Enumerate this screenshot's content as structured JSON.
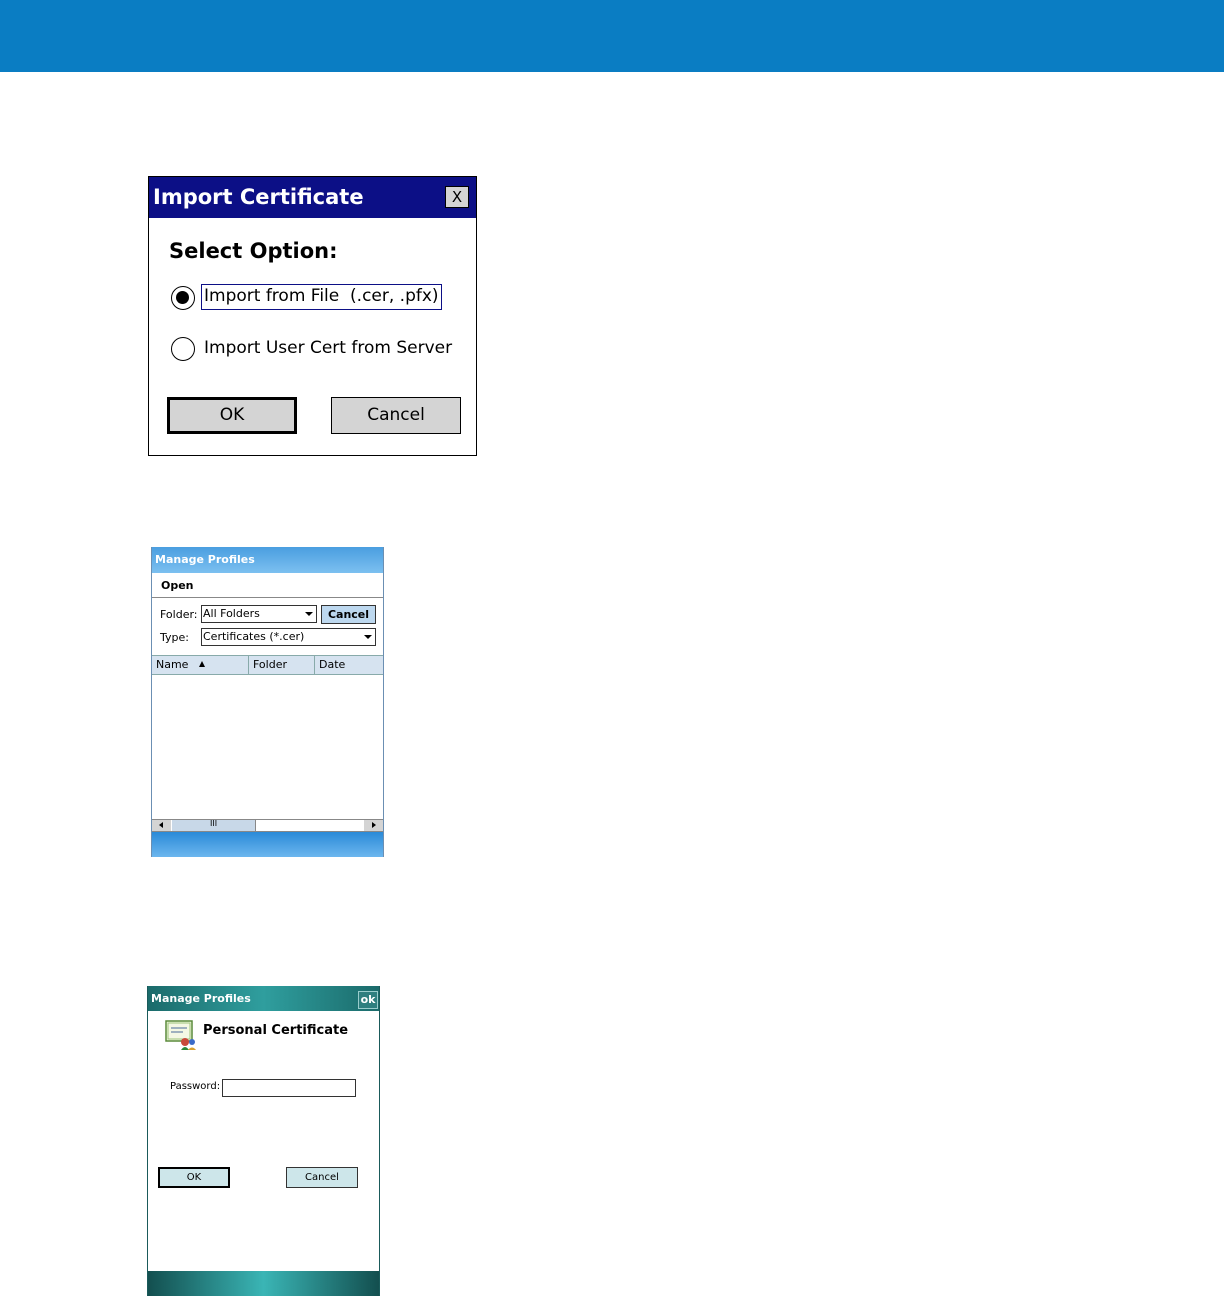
{
  "dialog_import": {
    "title": "Import Certificate",
    "close_label": "X",
    "heading": "Select Option:",
    "options": [
      {
        "label": "Import from File  (.cer, .pfx)",
        "selected": true
      },
      {
        "label": "Import User Cert from Server",
        "selected": false
      }
    ],
    "ok_label": "OK",
    "cancel_label": "Cancel"
  },
  "dialog_open": {
    "title": "Manage Profiles",
    "menu_label": "Open",
    "folder_label": "Folder:",
    "folder_value": "All Folders",
    "type_label": "Type:",
    "type_value": "Certificates (*.cer)",
    "cancel_label": "Cancel",
    "columns": [
      "Name",
      "Folder",
      "Date"
    ],
    "scroll_grip": "III"
  },
  "dialog_cert": {
    "title": "Manage Profiles",
    "ok_label": "ok",
    "heading": "Personal Certificate",
    "password_label": "Password:",
    "password_value": "",
    "ok_button_label": "OK",
    "cancel_label": "Cancel"
  },
  "colors": {
    "banner": "#0a7dc3",
    "import_titlebar": "#0c0f86",
    "open_titlebar": "#4a9ee0",
    "cert_titlebar": "#1b6b6b"
  }
}
